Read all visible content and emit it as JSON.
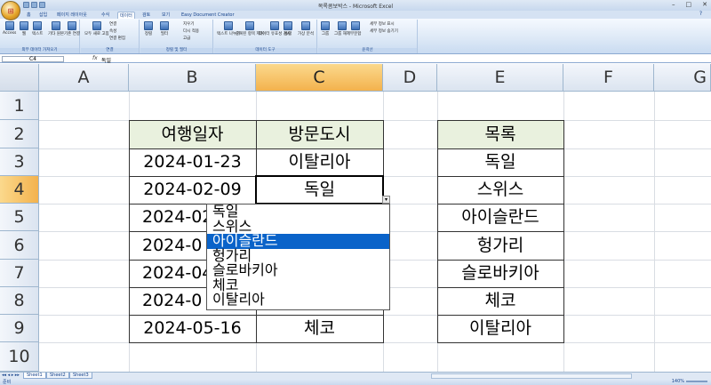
{
  "window": {
    "title": "목록콤보박스 - Microsoft Excel"
  },
  "ribbon": {
    "tabs": [
      "홈",
      "삽입",
      "페이지 레이아웃",
      "수식",
      "데이터",
      "검토",
      "보기",
      "Easy Document Creator"
    ],
    "active_tab": "데이터",
    "groups": [
      {
        "label": "외부 데이터 가져오기",
        "buttons": [
          "Access",
          "웹",
          "텍스트",
          "기타 원본",
          "기존 연결"
        ]
      },
      {
        "label": "연결",
        "buttons": [
          "모두 새로 고침",
          "연결",
          "속성",
          "연결 편집"
        ]
      },
      {
        "label": "정렬 및 필터",
        "buttons": [
          "정렬",
          "필터",
          "지우기",
          "다시 적용",
          "고급"
        ]
      },
      {
        "label": "데이터 도구",
        "buttons": [
          "텍스트 나누기",
          "중복된 항목 제거",
          "데이터 유효성 검사",
          "통합",
          "가상 분석"
        ]
      },
      {
        "label": "윤곽선",
        "buttons": [
          "그룹",
          "그룹 해제",
          "부분합",
          "세부 정보 표시",
          "세부 정보 숨기기"
        ]
      }
    ]
  },
  "formula_bar": {
    "name_box": "C4",
    "fx": "fx",
    "value": "독일"
  },
  "columns": [
    "A",
    "B",
    "C",
    "D",
    "E",
    "F",
    "G"
  ],
  "selected_column": "C",
  "rows": [
    "1",
    "2",
    "3",
    "4",
    "5",
    "6",
    "7",
    "8",
    "9",
    "10"
  ],
  "selected_row": "4",
  "table1": {
    "headers": [
      "여행일자",
      "방문도시"
    ],
    "rows": [
      [
        "2024-01-23",
        "이탈리아"
      ],
      [
        "2024-02-09",
        "독일"
      ],
      [
        "2024-02",
        ""
      ],
      [
        "2024-0",
        ""
      ],
      [
        "2024-04",
        ""
      ],
      [
        "2024-0",
        ""
      ],
      [
        "2024-05-16",
        "체코"
      ]
    ]
  },
  "table2": {
    "header": "목록",
    "items": [
      "독일",
      "스위스",
      "아이슬란드",
      "헝가리",
      "슬로바키아",
      "체코",
      "이탈리아"
    ]
  },
  "dropdown": {
    "items": [
      "독일",
      "스위스",
      "아이슬란드",
      "헝가리",
      "슬로바키아",
      "체코",
      "이탈리아"
    ],
    "highlighted_index": 2
  },
  "sheets": [
    "Sheet1",
    "Sheet2",
    "Sheet3"
  ],
  "active_sheet": "Sheet1",
  "status": {
    "left": "준비",
    "zoom": "140%"
  }
}
